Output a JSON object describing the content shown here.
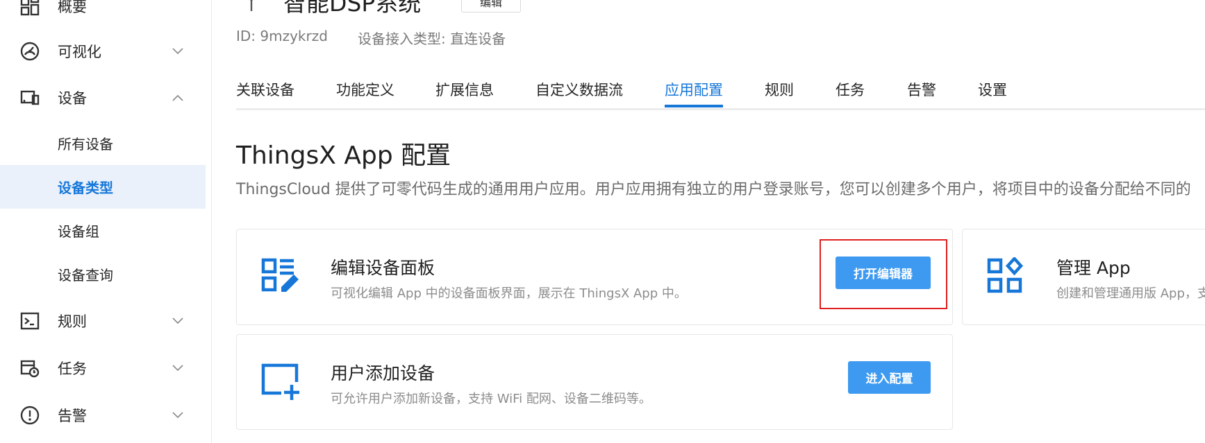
{
  "colors": {
    "accent": "#1677d9",
    "button": "#3d9af0",
    "highlight": "#e01e1e",
    "active_bg": "#eaf1fb"
  },
  "sidebar": {
    "items": [
      {
        "label": "概要",
        "icon": "dashboard-icon"
      },
      {
        "label": "可视化",
        "icon": "gauge-icon",
        "expanded": false
      },
      {
        "label": "设备",
        "icon": "devices-icon",
        "expanded": true
      },
      {
        "label": "规则",
        "icon": "terminal-icon",
        "expanded": false
      },
      {
        "label": "任务",
        "icon": "calendar-clock-icon",
        "expanded": false
      },
      {
        "label": "告警",
        "icon": "alert-circle-icon",
        "expanded": false
      }
    ],
    "device_sub": [
      {
        "label": "所有设备"
      },
      {
        "label": "设备类型",
        "active": true
      },
      {
        "label": "设备组"
      },
      {
        "label": "设备查询"
      }
    ]
  },
  "header": {
    "title": "智能DSP系统",
    "edit_label": "编辑",
    "id_text": "ID: 9mzykrzd",
    "access_type": "设备接入类型: 直连设备"
  },
  "tabs": [
    "关联设备",
    "功能定义",
    "扩展信息",
    "自定义数据流",
    "应用配置",
    "规则",
    "任务",
    "告警",
    "设置"
  ],
  "active_tab": "应用配置",
  "section": {
    "title": "ThingsX App 配置",
    "desc": "ThingsCloud 提供了可零代码生成的通用用户应用。用户应用拥有独立的用户登录账号，您可以创建多个用户，将项目中的设备分配给不同的"
  },
  "cards": {
    "panel": {
      "title": "编辑设备面板",
      "desc": "可视化编辑 App 中的设备面板界面，展示在 ThingsX App 中。",
      "button": "打开编辑器",
      "icon": "widgets-edit-icon"
    },
    "manage": {
      "title": "管理 App",
      "desc": "创建和管理通用版 App，支",
      "icon": "apps-grid-icon"
    },
    "add_device": {
      "title": "用户添加设备",
      "desc": "可允许用户添加新设备，支持 WiFi 配网、设备二维码等。",
      "button": "进入配置",
      "icon": "add-box-icon"
    }
  }
}
